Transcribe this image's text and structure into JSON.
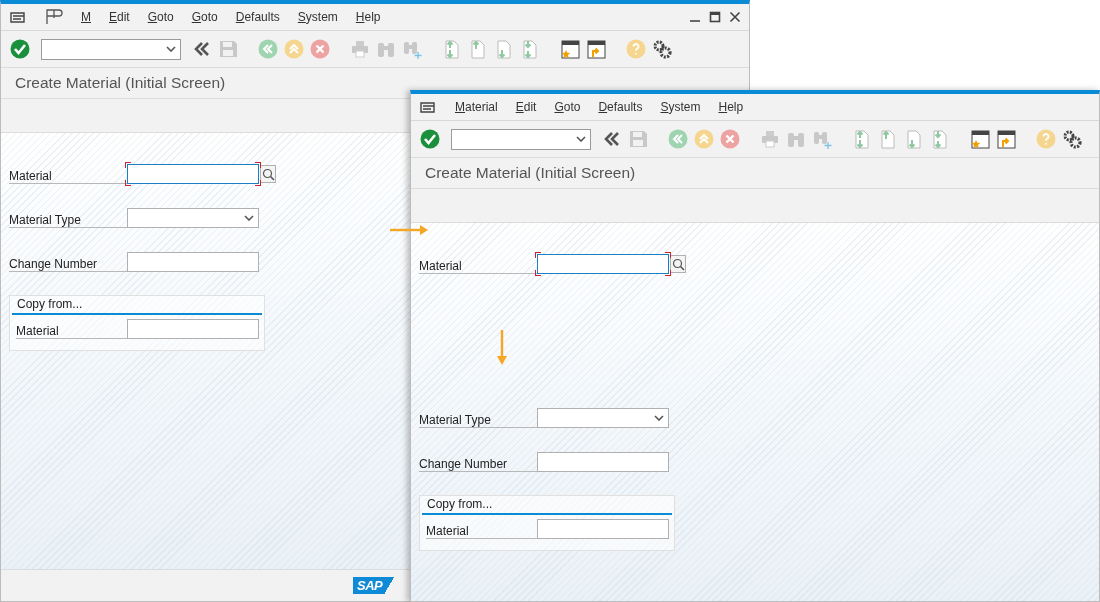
{
  "windows": [
    {
      "extra_menu_icon": true,
      "window_controls": true,
      "menu": [
        {
          "label": "M"
        },
        {
          "label": "Edit"
        },
        {
          "label": "Goto"
        },
        {
          "label": "Goto"
        },
        {
          "label": "Defaults"
        },
        {
          "label": "System"
        },
        {
          "label": "Help"
        }
      ],
      "title": "Create Material (Initial Screen)",
      "fields": [
        {
          "kind": "search",
          "label": "Material",
          "required": true,
          "focused": true
        },
        {
          "kind": "dropdown",
          "label": "Material Type",
          "required": false,
          "focused": false
        },
        {
          "kind": "text",
          "label": "Change Number",
          "required": false,
          "focused": false
        }
      ],
      "copy_from": {
        "title": "Copy from...",
        "fields": [
          {
            "kind": "text",
            "label": "Material",
            "required": false,
            "focused": false
          }
        ]
      },
      "footer_logo": "SAP"
    },
    {
      "extra_menu_icon": false,
      "window_controls": false,
      "menu": [
        {
          "label": "Material"
        },
        {
          "label": "Edit"
        },
        {
          "label": "Goto"
        },
        {
          "label": "Defaults"
        },
        {
          "label": "System"
        },
        {
          "label": "Help"
        }
      ],
      "title": "Create Material (Initial Screen)",
      "fields": [
        {
          "kind": "search",
          "label": "Material",
          "required": true,
          "focused": true
        },
        {
          "kind": "dropdown",
          "label": "Material Type",
          "required": false,
          "focused": false
        },
        {
          "kind": "text",
          "label": "Change Number",
          "required": false,
          "focused": false
        }
      ],
      "copy_from": {
        "title": "Copy from...",
        "fields": [
          {
            "kind": "text",
            "label": "Material",
            "required": false,
            "focused": false
          }
        ]
      }
    }
  ]
}
